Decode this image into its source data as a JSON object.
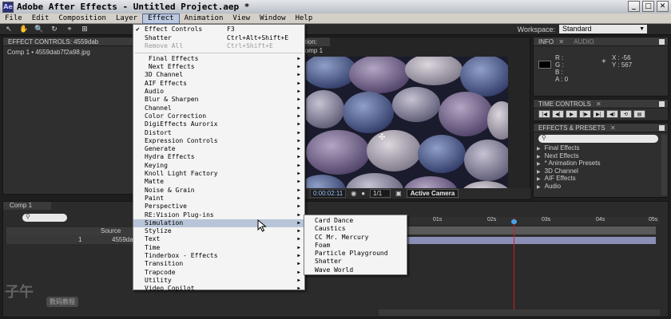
{
  "window": {
    "app_icon_label": "Ae",
    "title": "Adobe After Effects - Untitled Project.aep *",
    "controls": [
      "_",
      "□",
      "✕"
    ]
  },
  "menubar": [
    "File",
    "Edit",
    "Composition",
    "Layer",
    "Effect",
    "Animation",
    "View",
    "Window",
    "Help"
  ],
  "menubar_active": "Effect",
  "toolbar": {
    "tools": [
      "↖",
      "✋",
      "🔍",
      "↻",
      "⌖",
      "⊞"
    ],
    "workspace_label": "Workspace:",
    "workspace_value": "Standard"
  },
  "effect_controls": {
    "tab": "EFFECT CONTROLS: 4559dab",
    "subtitle": "Comp 1 • 4559dab7f2a98.jpg"
  },
  "composition": {
    "tab": "sition: Comp 1",
    "timecode": "0:00:02:11",
    "resolution": "1/1",
    "view": "Active Camera"
  },
  "info": {
    "tab": "INFO",
    "tab_inactive": "AUDIO",
    "r": "R :",
    "g": "G :",
    "b": "B :",
    "a": "A : 0",
    "x": "X : -56",
    "y": "Y : 567"
  },
  "time_controls": {
    "tab": "TIME CONTROLS",
    "buttons": [
      "|◀",
      "◀|",
      "▶",
      "|▶",
      "▶|",
      "◀)",
      "⟲",
      "▤"
    ]
  },
  "effects_presets": {
    "tab": "EFFECTS & PRESETS",
    "items": [
      "Final Effects",
      "Next Effects",
      "* Animation Presets",
      "3D Channel",
      "AIF Effects",
      "Audio"
    ]
  },
  "timeline": {
    "tab": "Comp 1",
    "header_source": "Source Name",
    "row_number": "1",
    "row_name": "4559da",
    "ruler": [
      "0s",
      "01s",
      "02s",
      "03s",
      "04s",
      "05s"
    ]
  },
  "watermark": {
    "text": "子午",
    "badge": "数码教程"
  },
  "effect_menu": {
    "top_items": [
      {
        "label": "Effect Controls",
        "shortcut": "F3",
        "checked": true
      },
      {
        "label": "Shatter",
        "shortcut": "Ctrl+Alt+Shift+E"
      },
      {
        "label": "Remove All",
        "shortcut": "Ctrl+Shift+E",
        "disabled": true
      }
    ],
    "categories": [
      " Final Effects",
      " Next Effects",
      "3D Channel",
      "AIF Effects",
      "Audio",
      "Blur & Sharpen",
      "Channel",
      "Color Correction",
      "DigiEffects Aurorix",
      "Distort",
      "Expression Controls",
      "Generate",
      "Hydra Effects",
      "Keying",
      "Knoll Light Factory",
      "Matte",
      "Noise & Grain",
      "Paint",
      "Perspective",
      "RE:Vision Plug-ins",
      "Simulation",
      "Stylize",
      "Text",
      "Time",
      "Tinderbox - Effects",
      "Transition",
      "Trapcode",
      "Utility",
      "Video Copilot"
    ],
    "highlighted": "Simulation"
  },
  "simulation_submenu": [
    "Card Dance",
    "Caustics",
    "CC Mr. Mercury",
    "Foam",
    "Particle Playground",
    "Shatter",
    "Wave World"
  ]
}
